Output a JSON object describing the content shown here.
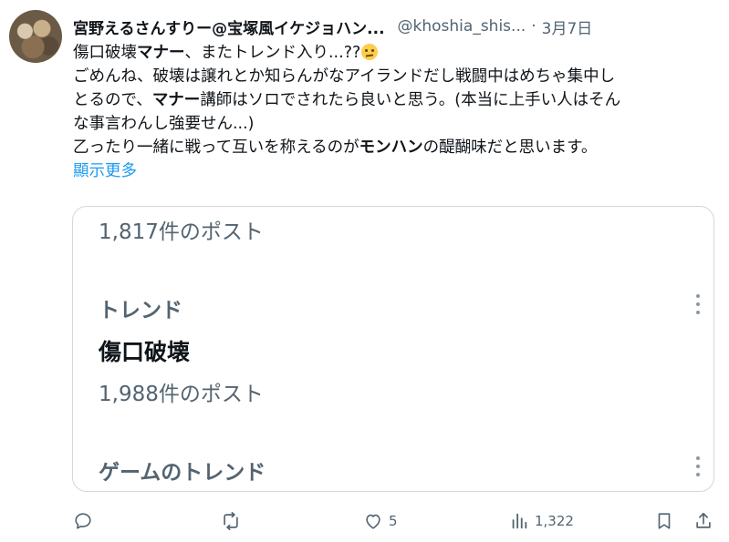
{
  "author": {
    "display_name": "宮野えるさんすりー@宝塚風イケジョハン...",
    "handle": "@khoshia_shis...",
    "separator": "·",
    "date": "3月7日"
  },
  "tweet": {
    "line1_a": "傷口破壊",
    "line1_b": "マナー",
    "line1_c": "、またトレンド入り...??",
    "emoji": "confused-face-emoji",
    "line2": "ごめんね、破壊は譲れとか知らんがなアイランドだし戦闘中はめちゃ集中し",
    "line3_a": "とるので、",
    "line3_b": "マナー",
    "line3_c": "講師はソロでされたら良いと思う。(本当に上手い人はそん",
    "line4": "な事言わんし強要せん...)",
    "line5_a": "乙ったり一緒に戦って互いを称えるのが",
    "line5_b": "モンハン",
    "line5_c": "の醍醐味だと思います。",
    "show_more": "顯示更多"
  },
  "card": {
    "post_count_1": "1,817件のポスト",
    "trend_label": "トレンド",
    "trend_title": "傷口破壊",
    "post_count_2": "1,988件のポスト",
    "game_trend_label": "ゲームのトレンド"
  },
  "actions": {
    "reply_count": "",
    "retweet_count": "",
    "like_count": "5",
    "view_count": "1,322"
  },
  "colors": {
    "link": "#1d9bf0",
    "muted": "#536471",
    "text": "#0f1419",
    "border": "#cfd9de"
  }
}
